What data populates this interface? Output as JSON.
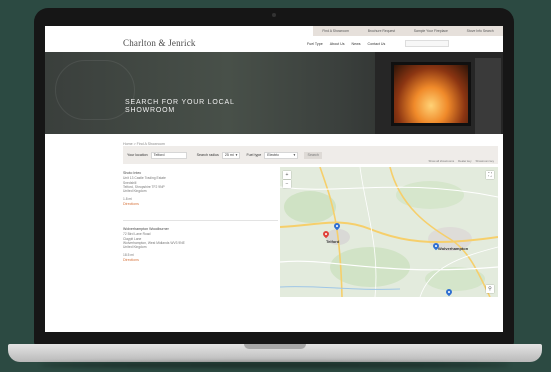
{
  "site": {
    "logo": "Charlton & Jenrick"
  },
  "utility_nav": [
    "Find A Showroom",
    "Brochure Request",
    "Sample Your Fireplace",
    "Stove Info Search"
  ],
  "main_nav": [
    "Fuel Type",
    "About Us",
    "News",
    "Contact Us"
  ],
  "hero": {
    "title": "SEARCH FOR YOUR LOCAL SHOWROOM"
  },
  "breadcrumb": "Home > Find A Showroom",
  "search": {
    "location_label": "Your location",
    "location_value": "Telford",
    "radius_label": "Search radius",
    "radius_value": "25 mi",
    "fuel_label": "Fuel type",
    "fuel_value": "Electric",
    "button_label": "Search",
    "key_links": [
      "Show all showrooms",
      "Dealer key",
      "Showroom key"
    ]
  },
  "results": [
    {
      "name": "Shoto Intec",
      "lines": [
        "Unit 13 Castle Trading Estate",
        "Snedshill",
        "Telford, Shropshire TF2 9NP",
        "United Kingdom"
      ],
      "distance": "1.8 mi",
      "link": "Directions"
    },
    {
      "name": "Wolverhampton Woodburner",
      "lines": [
        "72 Bird Lane Road",
        "Claypit Lane",
        "Wolverhampton, West Midlands WV3 9NE",
        "United Kingdom"
      ],
      "distance": "18.5 mi",
      "link": "Directions"
    }
  ],
  "map": {
    "cities": [
      "Telford",
      "Wolverhampton"
    ],
    "zoom_in": "+",
    "zoom_out": "−",
    "pin_colors": {
      "active": "#e0423a",
      "default": "#2f6fd1"
    }
  },
  "colors": {
    "accent": "#d7723a",
    "panel": "#efece9",
    "background": "#2c4a42"
  }
}
